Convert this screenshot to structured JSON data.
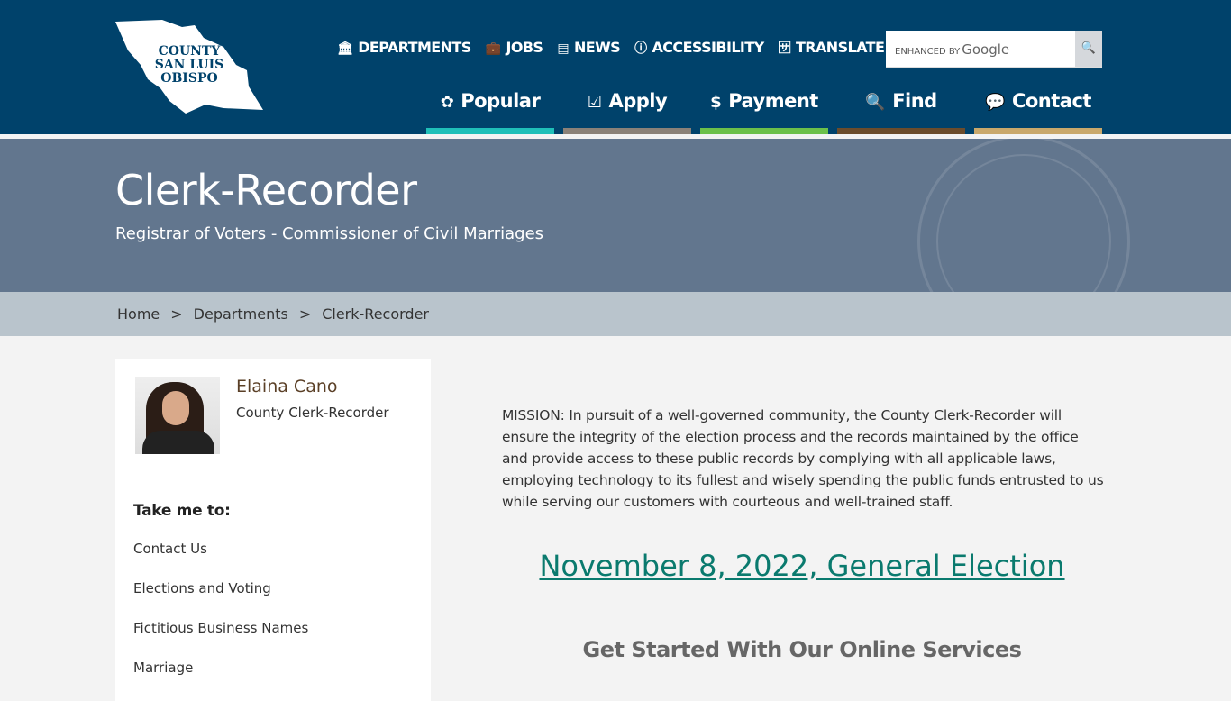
{
  "header": {
    "logo": "COUNTY of SAN LUIS OBISPO",
    "utility": [
      {
        "icon": "bank-icon",
        "glyph": "🏛",
        "label": "DEPARTMENTS"
      },
      {
        "icon": "briefcase-icon",
        "glyph": "💼",
        "label": "JOBS"
      },
      {
        "icon": "newspaper-icon",
        "glyph": "▤",
        "label": "NEWS"
      },
      {
        "icon": "accessibility-icon",
        "glyph": "ⓘ",
        "label": "ACCESSIBILITY"
      },
      {
        "icon": "translate-icon",
        "glyph": "🈂",
        "label": "TRANSLATE"
      }
    ],
    "search": {
      "enhanced": "ENHANCED BY",
      "brand": "Google"
    },
    "nav": [
      {
        "label": "Popular",
        "glyph": "✿",
        "icon": "gear-icon",
        "color": "#1fbfb8"
      },
      {
        "label": "Apply",
        "glyph": "☑",
        "icon": "checkbox-icon",
        "color": "#8a8178"
      },
      {
        "label": "Payment",
        "glyph": "$",
        "icon": "dollar-icon",
        "color": "#6cc04a"
      },
      {
        "label": "Find",
        "glyph": "🔍",
        "icon": "search-icon",
        "color": "#6b4c2c"
      },
      {
        "label": "Contact",
        "glyph": "💬",
        "icon": "chat-icon",
        "color": "#c9a86b"
      }
    ]
  },
  "banner": {
    "title": "Clerk-Recorder",
    "subtitle": "Registrar of Voters - Commissioner of Civil Marriages"
  },
  "breadcrumb": [
    "Home",
    "Departments",
    "Clerk-Recorder"
  ],
  "sidebar": {
    "name": "Elaina Cano",
    "role": "County Clerk-Recorder",
    "take_me_to": "Take me to:",
    "links": [
      "Contact Us",
      "Elections and Voting",
      "Fictitious Business Names",
      "Marriage"
    ]
  },
  "main": {
    "mission": "MISSION: In pursuit of a well-governed community, the County Clerk-Recorder will ensure the integrity of the election process and the records maintained by the office and provide access to these public records by complying with all applicable laws, employing technology to its fullest and wisely spending the public funds entrusted to us while serving our customers with courteous and well-trained staff.",
    "election_link": "November 8, 2022, General Election",
    "services_heading": "Get Started With Our Online Services"
  }
}
